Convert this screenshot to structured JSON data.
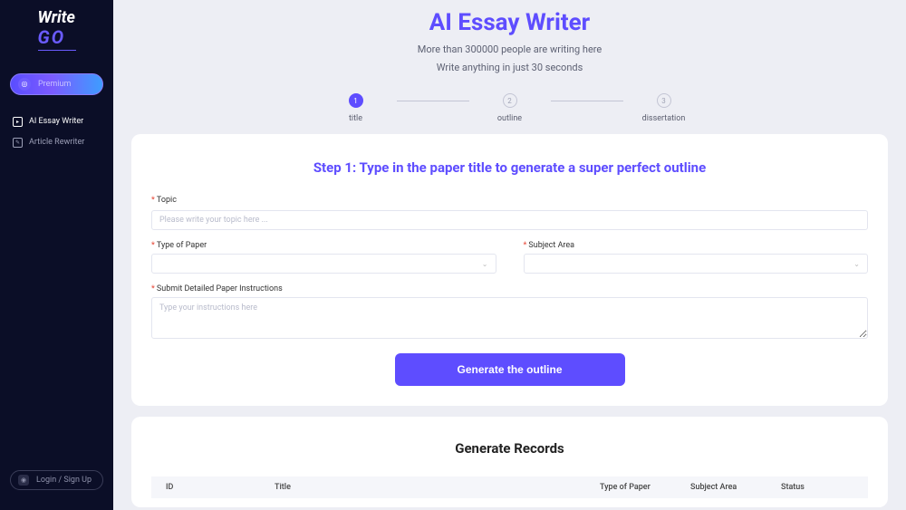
{
  "brand": {
    "line1": "Write",
    "line2": "GO"
  },
  "sidebar": {
    "premium_label": "Premium",
    "items": [
      {
        "label": "AI Essay Writer",
        "active": true
      },
      {
        "label": "Article Rewriter",
        "active": false
      }
    ],
    "login_label": "Login / Sign Up"
  },
  "hero": {
    "title": "AI Essay Writer",
    "sub1": "More than 300000 people are writing here",
    "sub2": "Write anything in just 30 seconds"
  },
  "steps": [
    {
      "num": "1",
      "label": "title",
      "active": true
    },
    {
      "num": "2",
      "label": "outline",
      "active": false
    },
    {
      "num": "3",
      "label": "dissertation",
      "active": false
    }
  ],
  "form": {
    "title": "Step 1: Type in the paper title to generate a super perfect outline",
    "topic_label": "Topic",
    "topic_placeholder": "Please write your topic here ...",
    "type_label": "Type of Paper",
    "subject_label": "Subject Area",
    "instructions_label": "Submit Detailed Paper Instructions",
    "instructions_placeholder": "Type your instructions here",
    "generate_label": "Generate the outline"
  },
  "records": {
    "title": "Generate Records",
    "columns": {
      "id": "ID",
      "title": "Title",
      "type": "Type of Paper",
      "subject": "Subject Area",
      "status": "Status"
    }
  }
}
